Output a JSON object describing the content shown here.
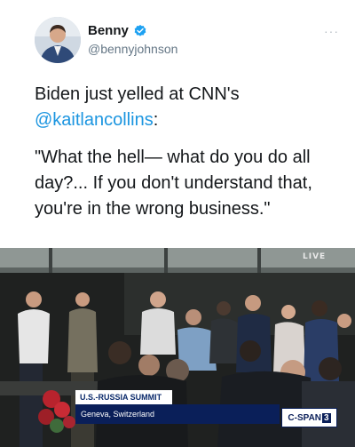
{
  "author": {
    "display_name": "Benny",
    "handle": "@bennyjohnson",
    "verified_icon": "verified-badge-icon",
    "verified_color": "#1da1f2"
  },
  "menu": {
    "label": "···",
    "icon": "more-options-icon"
  },
  "tweet": {
    "line1_prefix": "Biden just yelled at CNN's",
    "mention": "@kaitlancollins",
    "line1_suffix": ":",
    "quote": "\"What the hell— what do you do all day?... If you don't understand that, you're in the wrong business.\"",
    "mention_color": "#1b95e0"
  },
  "video": {
    "live_label": "LIVE",
    "banner_title": "U.S.-RUSSIA SUMMIT",
    "banner_location": "Geneva, Switzerland",
    "network": "C-SPAN",
    "network_number": "3",
    "banner_color": "#0a1f59"
  }
}
